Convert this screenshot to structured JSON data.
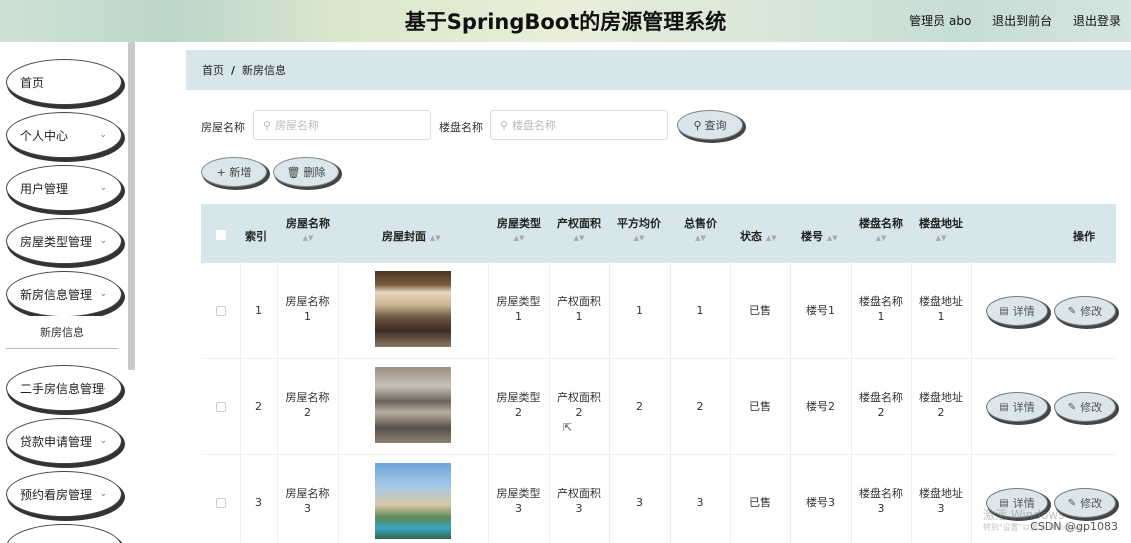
{
  "header": {
    "title": "基于SpringBoot的房源管理系统",
    "admin": "管理员 abo",
    "to_front": "退出到前台",
    "logout": "退出登录"
  },
  "sidebar": {
    "items": [
      {
        "label": "首页",
        "has_chevron": false
      },
      {
        "label": "个人中心",
        "has_chevron": true
      },
      {
        "label": "用户管理",
        "has_chevron": true
      },
      {
        "label": "房屋类型管理",
        "has_chevron": true
      },
      {
        "label": "新房信息管理",
        "has_chevron": true
      },
      {
        "label": "二手房信息管理",
        "has_chevron": true
      },
      {
        "label": "贷款申请管理",
        "has_chevron": true
      },
      {
        "label": "预约看房管理",
        "has_chevron": true
      }
    ],
    "submenu": "新房信息",
    "chevron_icon": "chevron-down-icon"
  },
  "breadcrumb": {
    "home": "首页",
    "sep": "/",
    "current": "新房信息"
  },
  "search": {
    "house_label": "房屋名称",
    "house_placeholder": "房屋名称",
    "building_label": "楼盘名称",
    "building_placeholder": "楼盘名称",
    "query_button": "查询"
  },
  "toolbar": {
    "add_button": "+ 新增",
    "delete_button": "删除"
  },
  "table": {
    "headers": {
      "index": "索引",
      "name": "房屋名称",
      "cover": "房屋封面",
      "type": "房屋类型",
      "area": "产权面积",
      "avg": "平方均价",
      "total": "总售价",
      "status": "状态",
      "building_no": "楼号",
      "estate": "楼盘名称",
      "address": "楼盘地址",
      "ops": "操作"
    },
    "rows": [
      {
        "index": "1",
        "name": "房屋名称\n1",
        "type": "房屋类型\n1",
        "area": "产权面积\n1",
        "avg": "1",
        "total": "1",
        "status": "已售",
        "building_no": "楼号1",
        "estate": "楼盘名称\n1",
        "address": "楼盘地址\n1"
      },
      {
        "index": "2",
        "name": "房屋名称\n2",
        "type": "房屋类型\n2",
        "area": "产权面积\n2",
        "avg": "2",
        "total": "2",
        "status": "已售",
        "building_no": "楼号2",
        "estate": "楼盘名称\n2",
        "address": "楼盘地址\n2"
      },
      {
        "index": "3",
        "name": "房屋名称\n3",
        "type": "房屋类型\n3",
        "area": "产权面积\n3",
        "avg": "3",
        "total": "3",
        "status": "已售",
        "building_no": "楼号3",
        "estate": "楼盘名称\n3",
        "address": "楼盘地址\n3"
      }
    ],
    "detail_button": "详情",
    "edit_button": "修改"
  },
  "watermark": {
    "line1": "激活 Windows",
    "line2": "转到\"设置\"以激活 Windows。"
  },
  "csdn": "CSDN @gp1083"
}
